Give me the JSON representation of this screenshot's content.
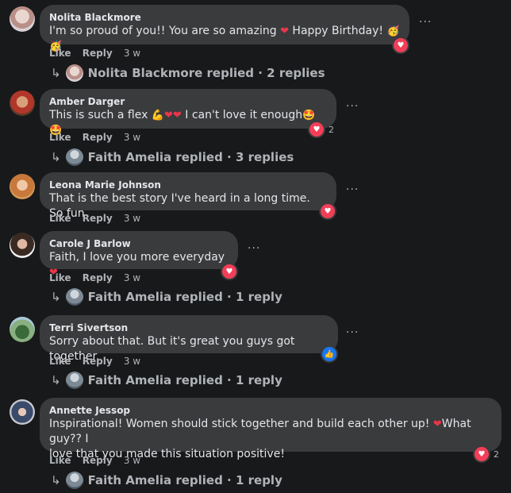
{
  "actions": {
    "like": "Like",
    "reply": "Reply"
  },
  "icons": {
    "more": "more-options-icon",
    "reply_arrow": "reply-arrow-icon",
    "love": "love-reaction-icon",
    "like": "like-reaction-icon"
  },
  "colors": {
    "love": "#f33e58",
    "like": "#1877f2",
    "bubble": "#3a3b3c",
    "background": "#18191a"
  },
  "comments": [
    {
      "author": "Nolita Blackmore",
      "text_before": "I'm so proud of you!! You are so amazing ",
      "text_after": " Happy Birthday! ",
      "time": "3 w",
      "reactions": {
        "type": "love",
        "count": ""
      },
      "replies": "Nolita Blackmore replied · 2 replies"
    },
    {
      "author": "Amber Darger",
      "text_before": "This is such a flex ",
      "text_after": " I can't love it enough",
      "time": "3 w",
      "reactions": {
        "type": "love",
        "count": "2"
      },
      "replies": "Faith Amelia replied · 3 replies"
    },
    {
      "author": "Leona Marie Johnson",
      "text": "That is the best story I've heard in a long time. So fun",
      "time": "3 w",
      "reactions": {
        "type": "love",
        "count": ""
      },
      "replies": ""
    },
    {
      "author": "Carole J Barlow",
      "text": "Faith, I love you more everyday ",
      "time": "3 w",
      "reactions": {
        "type": "love",
        "count": ""
      },
      "replies": "Faith Amelia replied · 1 reply"
    },
    {
      "author": "Terri Sivertson",
      "text": "Sorry about that. But it's great you guys got together.",
      "time": "3 w",
      "reactions": {
        "type": "like",
        "count": ""
      },
      "replies": "Faith Amelia replied · 1 reply"
    },
    {
      "author": "Annette Jessop",
      "text_line1_before": "Inspirational! Women should stick together and build each other up! ",
      "text_line1_after": "What guy?? I",
      "text_line2": "love that you made this situation positive!",
      "time": "3 w",
      "reactions": {
        "type": "love",
        "count": "2"
      },
      "replies": "Faith Amelia replied · 1 reply"
    }
  ]
}
